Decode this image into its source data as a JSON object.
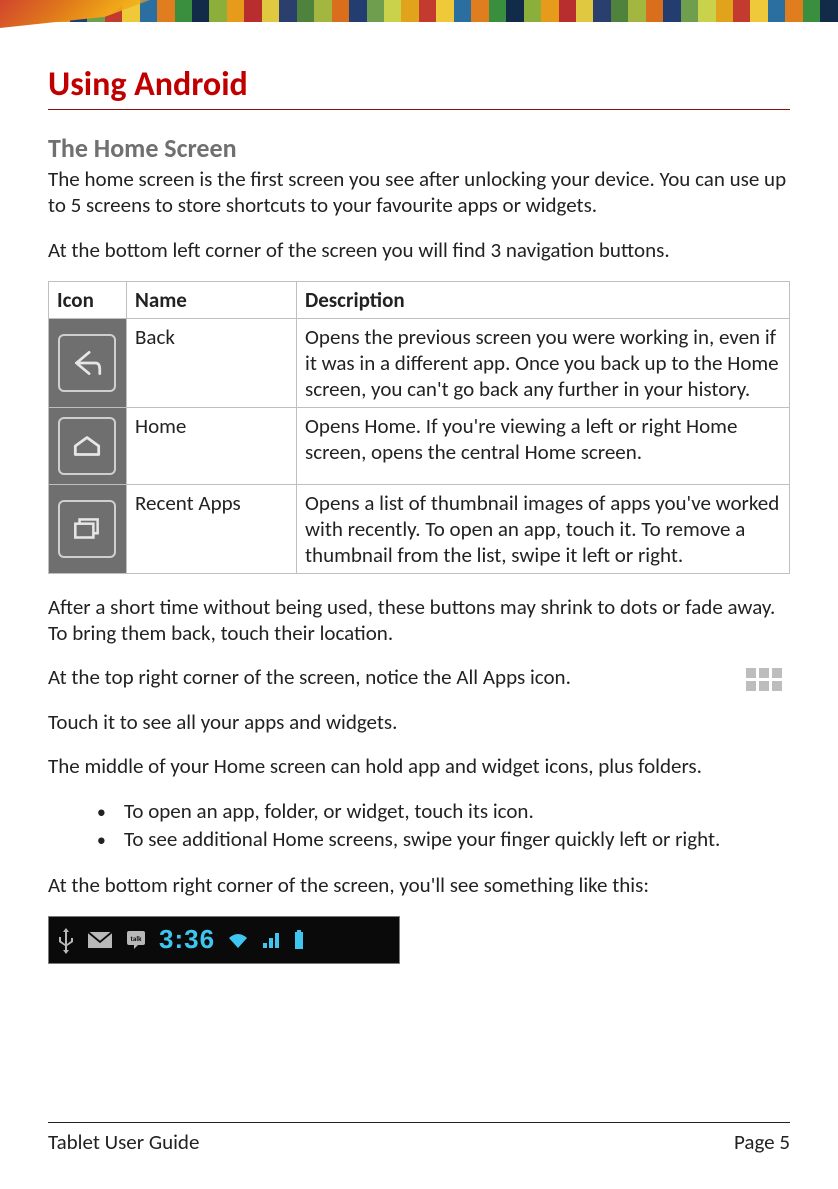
{
  "topStripes": [
    "#3a5a2b",
    "#4f833d",
    "#c9d24a",
    "#e0a31b",
    "#243d70",
    "#6f9f4e",
    "#c23b2e",
    "#f0c93a",
    "#2a6fa0",
    "#e07d1f",
    "#3a8f3f",
    "#122b49",
    "#8cae3b",
    "#e69b1a",
    "#b82e2e",
    "#e0c841",
    "#2a3f6e",
    "#4f833d",
    "#a3b63f",
    "#d96f1c",
    "#243d70",
    "#6f9f4e",
    "#c9d24a",
    "#e0a31b",
    "#c23b2e",
    "#f0c93a",
    "#2a6fa0",
    "#e07d1f",
    "#3a8f3f",
    "#122b49",
    "#8cae3b",
    "#e69b1a",
    "#b82e2e",
    "#e0c841",
    "#2a3f6e",
    "#4f833d",
    "#a3b63f",
    "#d96f1c",
    "#243d70",
    "#6f9f4e",
    "#c9d24a",
    "#e0a31b",
    "#c23b2e",
    "#f0c93a",
    "#2a6fa0",
    "#e07d1f",
    "#3a8f3f",
    "#122b49"
  ],
  "heading": "Using Android",
  "subheading": "The Home Screen",
  "intro_p1": "The home screen is the first screen you see after unlocking your device. You can use up to 5 screens to store shortcuts to your favourite apps or widgets.",
  "intro_p2": "At the bottom left corner of the screen you will find 3 navigation buttons.",
  "table": {
    "headers": {
      "icon": "Icon",
      "name": "Name",
      "desc": "Description"
    },
    "rows": [
      {
        "name": "Back",
        "desc": "Opens the previous screen you were working in, even if it was in a different app. Once you back up to the Home screen, you can't go back any further in your history."
      },
      {
        "name": "Home",
        "desc": "Opens Home. If you're viewing a left or right Home screen, opens the central Home screen."
      },
      {
        "name": "Recent Apps",
        "desc": "Opens a list of thumbnail images of apps you've worked with recently. To open an app, touch it. To remove a thumbnail from the list, swipe it left or right."
      }
    ]
  },
  "after_table_p1": "After a short time without being used, these buttons may shrink to dots or fade away. To bring them back, touch their location.",
  "all_apps_p": "At the top right corner of the screen, notice the All Apps icon.",
  "touch_p": "Touch it to see all your apps and widgets.",
  "middle_p": "The middle of your Home screen can hold app and widget icons, plus folders.",
  "bullets": [
    "To open an app, folder, or widget, touch its icon.",
    "To see additional Home screens, swipe your finger quickly left or right."
  ],
  "bottom_right_p": "At the bottom right corner of the screen, you'll see something like this:",
  "status": {
    "time": "3:36"
  },
  "footer": {
    "left": "Tablet User Guide",
    "right": "Page 5"
  }
}
